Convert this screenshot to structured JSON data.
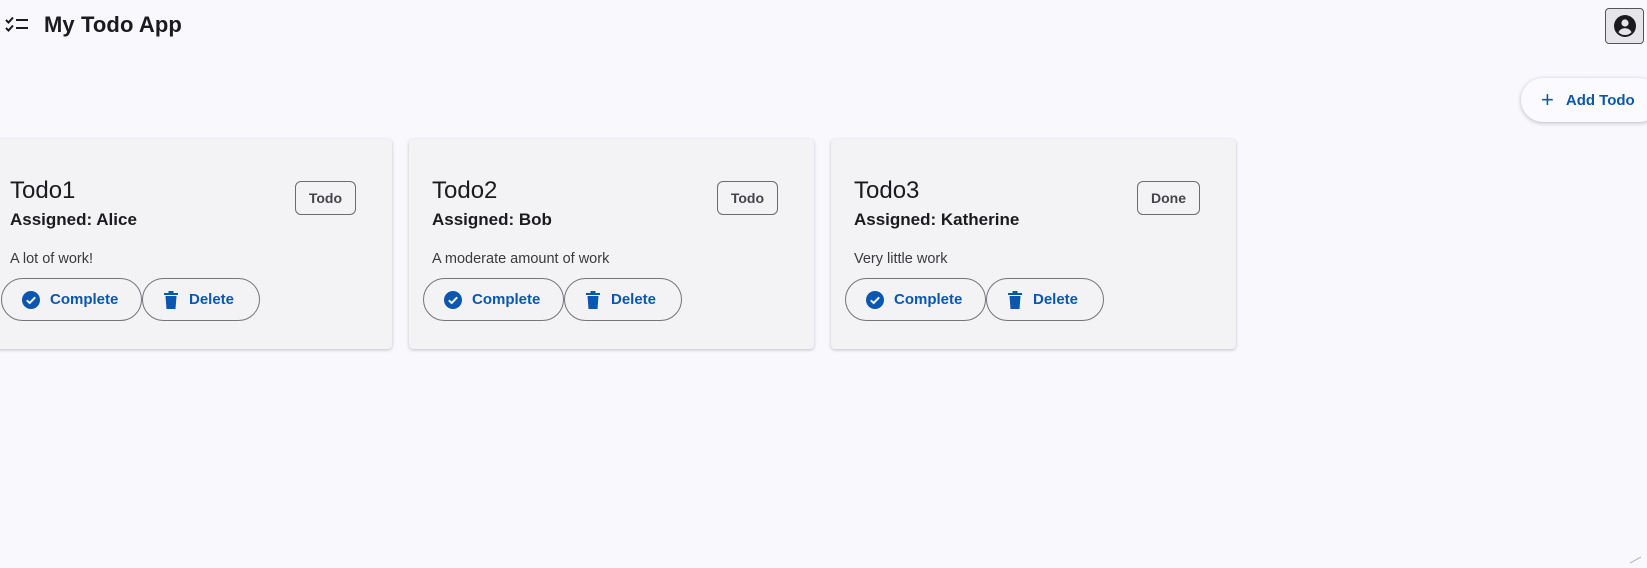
{
  "app": {
    "title": "My Todo App",
    "icon": "checklist-icon",
    "account_icon": "account-circle-icon"
  },
  "toolbar": {
    "add_label": "Add Todo",
    "add_icon": "plus-icon"
  },
  "colors": {
    "accent": "#0b57b0",
    "background": "#f9f8fd",
    "card": "#f3f3f5"
  },
  "todos": [
    {
      "title": "Todo1",
      "assigned": "Assigned: Alice",
      "status": "Todo",
      "description": "A lot of work!",
      "complete_label": "Complete",
      "delete_label": "Delete"
    },
    {
      "title": "Todo2",
      "assigned": "Assigned: Bob",
      "status": "Todo",
      "description": "A moderate amount of work",
      "complete_label": "Complete",
      "delete_label": "Delete"
    },
    {
      "title": "Todo3",
      "assigned": "Assigned: Katherine",
      "status": "Done",
      "description": "Very little work",
      "complete_label": "Complete",
      "delete_label": "Delete"
    }
  ]
}
